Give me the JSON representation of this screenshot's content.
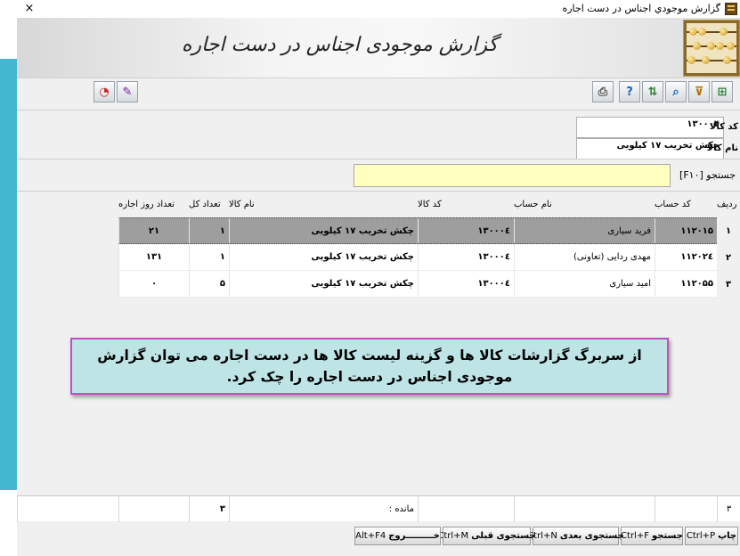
{
  "window": {
    "title": "گزارش موجودي اجناس در دست اجاره",
    "close_glyph": "×"
  },
  "banner": {
    "heading": "گزارش موجودی اجناس در دست اجاره"
  },
  "toolbar": {
    "right_buttons": [
      {
        "name": "excel-icon",
        "glyph": "⊞",
        "color": "#2e7d32"
      },
      {
        "name": "filter-icon",
        "glyph": "⊽",
        "color": "#b07000"
      },
      {
        "name": "search-icon",
        "glyph": "⌕",
        "color": "#1565c0"
      },
      {
        "name": "sort-icon",
        "glyph": "⇅",
        "color": "#2e7d32"
      },
      {
        "name": "help-icon",
        "glyph": "?",
        "color": "#1565c0"
      },
      {
        "name": "print-icon",
        "glyph": "⎙",
        "color": "#555555"
      }
    ],
    "left_buttons": [
      {
        "name": "chart-icon",
        "glyph": "◔",
        "color": "#c62828"
      },
      {
        "name": "palette-icon",
        "glyph": "✎",
        "color": "#6a1b9a"
      }
    ]
  },
  "filters": {
    "item_code_label": "کد کالا",
    "item_code_value": "۱۳۰۰۰۴",
    "item_name_label": "نام کالا",
    "item_name_value": "چکش تخریب ۱۷ کیلویی"
  },
  "search": {
    "label": "جستجو [F۱۰]",
    "value": ""
  },
  "table": {
    "columns": {
      "row_no": "ردیف",
      "account_code": "کد حساب",
      "account_name": "نام حساب",
      "item_code": "کد کالا",
      "item_name": "نام کالا",
      "total_count": "تعداد کل",
      "rental_days": "تعداد روز اجاره"
    },
    "rows": [
      {
        "row_no": "۱",
        "account_code": "۱۱۲۰۱۵",
        "account_name": "فرید سیاری",
        "item_code": "۱۳۰۰۰٤",
        "item_name": "چکش تخریب ۱۷ کیلویی",
        "total_count": "۱",
        "rental_days": "۲۱",
        "selected": true
      },
      {
        "row_no": "۲",
        "account_code": "۱۱۲۰۲٤",
        "account_name": "مهدی ردایی (تعاونی)",
        "item_code": "۱۳۰۰۰٤",
        "item_name": "چکش تخریب ۱۷ کیلویی",
        "total_count": "۱",
        "rental_days": "۱۳۱",
        "selected": false
      },
      {
        "row_no": "۳",
        "account_code": "۱۱۲۰۵۵",
        "account_name": "امید سیاری",
        "item_code": "۱۳۰۰۰٤",
        "item_name": "چکش تخریب ۱۷ کیلویی",
        "total_count": "۵",
        "rental_days": "۰",
        "selected": false
      }
    ]
  },
  "callout": {
    "text": "از سربرگ گزارشات کالا ها و گزینه لیست کالا ها در دست اجاره می توان گزارش موجودی اجناس در دست اجاره را چک کرد."
  },
  "footer": {
    "row_count": "۳",
    "balance_label": "مانده :",
    "total_count": "۳"
  },
  "actions": {
    "print": {
      "label": "چاپ",
      "key": "Ctrl+P"
    },
    "search": {
      "label": "جستجو",
      "key": "Ctrl+F"
    },
    "next": {
      "label": "جستجوی بعدی",
      "key": "Ctrl+N"
    },
    "prev": {
      "label": "جستجوی قبلی",
      "key": "Ctrl+M"
    },
    "exit": {
      "label": "خـــــــــروج",
      "key": "Alt+F4"
    }
  }
}
